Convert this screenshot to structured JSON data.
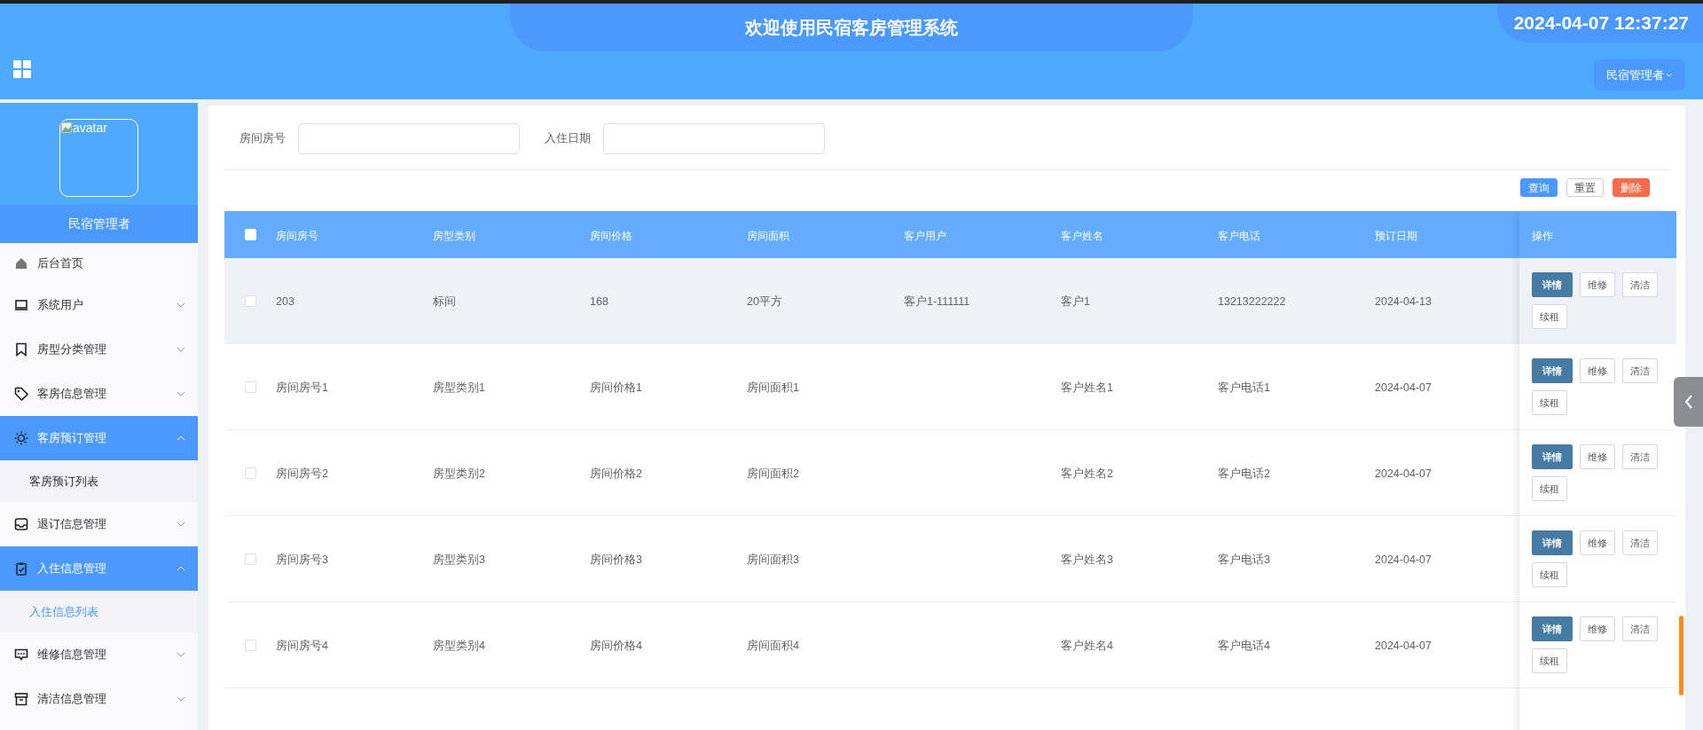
{
  "header": {
    "title": "欢迎使用民宿客房管理系统",
    "datetime": "2024-04-07 12:37:27",
    "user_menu": "民宿管理者"
  },
  "sidebar": {
    "avatar_alt": "avatar",
    "user_name": "民宿管理者",
    "menu": [
      {
        "label": "后台首页",
        "kind": "link",
        "selected": false
      },
      {
        "label": "系统用户",
        "kind": "submenu",
        "selected": false,
        "expanded": false
      },
      {
        "label": "房型分类管理",
        "kind": "submenu",
        "selected": false,
        "expanded": false
      },
      {
        "label": "客房信息管理",
        "kind": "submenu",
        "selected": false,
        "expanded": false
      },
      {
        "label": "客房预订管理",
        "kind": "submenu",
        "selected": true,
        "expanded": true,
        "children": [
          {
            "label": "客房预订列表",
            "selected": false
          }
        ]
      },
      {
        "label": "退订信息管理",
        "kind": "submenu",
        "selected": false,
        "expanded": false
      },
      {
        "label": "入住信息管理",
        "kind": "submenu",
        "selected": true,
        "expanded": true,
        "children": [
          {
            "label": "入住信息列表",
            "selected": true
          }
        ]
      },
      {
        "label": "维修信息管理",
        "kind": "submenu",
        "selected": false,
        "expanded": false
      },
      {
        "label": "清洁信息管理",
        "kind": "submenu",
        "selected": false,
        "expanded": false
      }
    ]
  },
  "search": {
    "fields": [
      {
        "label": "房间房号"
      },
      {
        "label": "入住日期"
      }
    ],
    "buttons": [
      {
        "label": "查询",
        "kind": "primary"
      },
      {
        "label": "重置",
        "kind": "plain"
      },
      {
        "label": "删除",
        "kind": "danger"
      }
    ]
  },
  "table": {
    "select_all_checked": false,
    "columns": [
      "房间房号",
      "房型类别",
      "房间价格",
      "房间面积",
      "客户用户",
      "客户姓名",
      "客户电话",
      "预订日期",
      "操作"
    ],
    "rows": [
      {
        "checked": false,
        "hovered": true,
        "cells": [
          "203",
          "标间",
          "168",
          "20平方",
          "客户1-111111",
          "客户1",
          "13213222222",
          "2024-04-13"
        ],
        "actions": [
          "详情",
          "维修",
          "清洁",
          "续租"
        ]
      },
      {
        "checked": false,
        "hovered": false,
        "cells": [
          "房间房号1",
          "房型类别1",
          "房间价格1",
          "房间面积1",
          "",
          "客户姓名1",
          "客户电话1",
          "2024-04-07"
        ],
        "actions": [
          "详情",
          "维修",
          "清洁",
          "续租"
        ]
      },
      {
        "checked": false,
        "hovered": false,
        "cells": [
          "房间房号2",
          "房型类别2",
          "房间价格2",
          "房间面积2",
          "",
          "客户姓名2",
          "客户电话2",
          "2024-04-07"
        ],
        "actions": [
          "详情",
          "维修",
          "清洁",
          "续租"
        ]
      },
      {
        "checked": false,
        "hovered": false,
        "cells": [
          "房间房号3",
          "房型类别3",
          "房间价格3",
          "房间面积3",
          "",
          "客户姓名3",
          "客户电话3",
          "2024-04-07"
        ],
        "actions": [
          "详情",
          "维修",
          "清洁",
          "续租"
        ]
      },
      {
        "checked": false,
        "hovered": false,
        "cells": [
          "房间房号4",
          "房型类别4",
          "房间价格4",
          "房间面积4",
          "",
          "客户姓名4",
          "客户电话4",
          "2024-04-07"
        ],
        "actions": [
          "详情",
          "维修",
          "清洁",
          "续租"
        ]
      }
    ]
  }
}
